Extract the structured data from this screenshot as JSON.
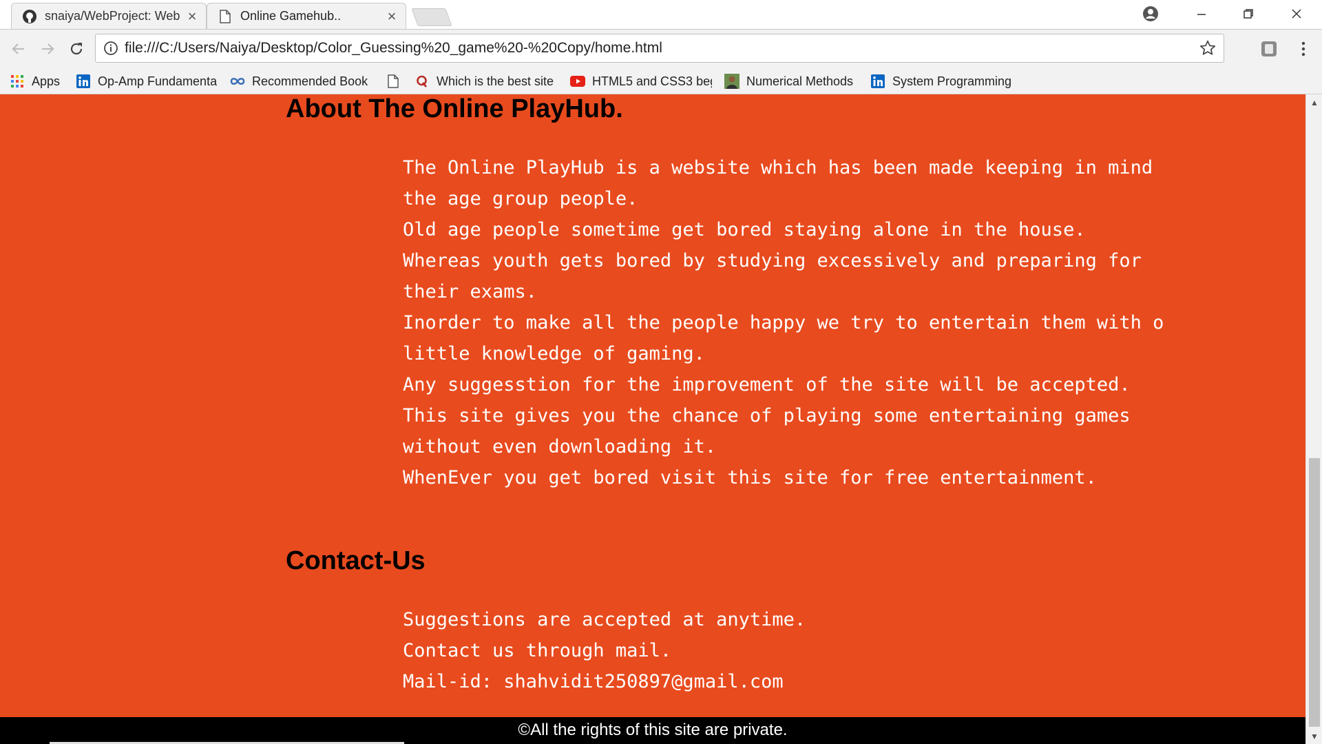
{
  "browser": {
    "tabs": [
      {
        "title": "snaiya/WebProject: Web",
        "icon": "github-icon",
        "active": false
      },
      {
        "title": "Online Gamehub..",
        "icon": "page-icon",
        "active": true
      }
    ],
    "url": "file:///C:/Users/Naiya/Desktop/Color_Guessing%20_game%20-%20Copy/home.html",
    "bookmarks": [
      {
        "label": "Apps",
        "icon": "apps-grid-icon"
      },
      {
        "label": "Op-Amp Fundamenta",
        "icon": "linkedin-icon"
      },
      {
        "label": "Recommended Book",
        "icon": "infinity-icon"
      },
      {
        "label": "",
        "icon": "page-icon"
      },
      {
        "label": "Which is the best site",
        "icon": "quora-icon"
      },
      {
        "label": "HTML5 and CSS3 beg",
        "icon": "youtube-icon"
      },
      {
        "label": "Numerical Methods",
        "icon": "avatar-icon"
      },
      {
        "label": "System Programming",
        "icon": "linkedin-icon"
      }
    ]
  },
  "page": {
    "about": {
      "title": "About The Online PlayHub.",
      "lines": [
        "The Online PlayHub is a website which has been made keeping in mind",
        "the age group people.",
        "Old age people sometime get bored staying alone in the house.",
        "Whereas youth gets bored by studying excessively and preparing for",
        "their exams.",
        "Inorder to make all the people happy we try to entertain them with o",
        "little knowledge of gaming.",
        "Any suggesstion for the improvement of the site will be accepted.",
        "This site gives you the chance of playing some entertaining games",
        "without even downloading it.",
        "WhenEver you get bored visit this site for free entertainment."
      ]
    },
    "contact": {
      "title": "Contact-Us",
      "lines": [
        "Suggestions are accepted at anytime.",
        "Contact us through mail.",
        "Mail-id: shahvidit250897@gmail.com"
      ]
    },
    "footer": "©All the rights of this site are private."
  },
  "colors": {
    "page_background": "#e84b1e",
    "body_text": "#ffffff",
    "heading_text": "#000000",
    "footer_background": "#000000"
  }
}
